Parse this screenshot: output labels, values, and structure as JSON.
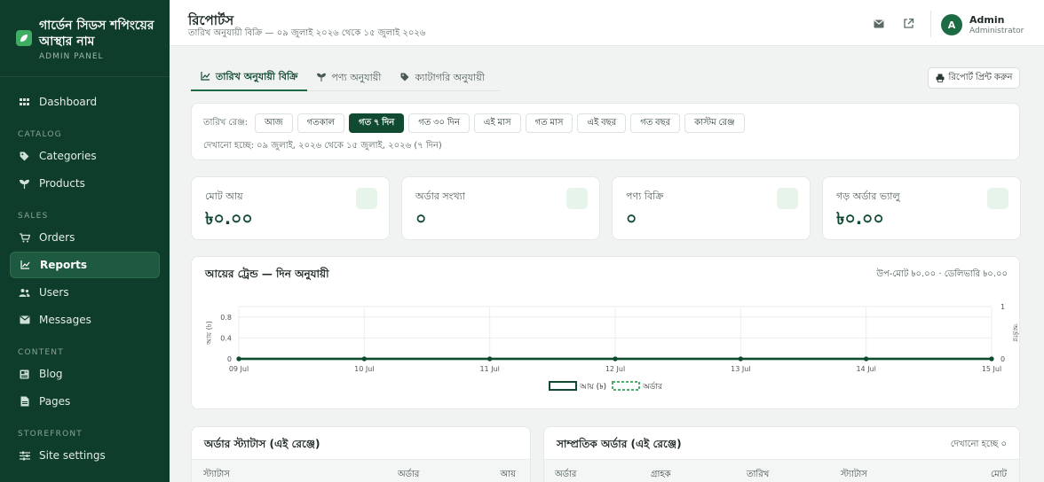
{
  "brand": {
    "title_line1": "গার্ডেন সিডস শপিংয়ের",
    "title_line2": "আস্থার নাম",
    "subtitle": "ADMIN PANEL"
  },
  "sidebar": {
    "items": [
      {
        "label": "Dashboard",
        "icon": "grid-icon"
      },
      {
        "section": "CATALOG"
      },
      {
        "label": "Categories",
        "icon": "tag-icon"
      },
      {
        "label": "Products",
        "icon": "sprout-icon"
      },
      {
        "section": "SALES"
      },
      {
        "label": "Orders",
        "icon": "cart-icon"
      },
      {
        "label": "Reports",
        "icon": "chart-line-icon",
        "active": true
      },
      {
        "label": "Users",
        "icon": "users-icon"
      },
      {
        "label": "Messages",
        "icon": "mail-icon"
      },
      {
        "section": "CONTENT"
      },
      {
        "label": "Blog",
        "icon": "newspaper-icon"
      },
      {
        "label": "Pages",
        "icon": "file-icon"
      },
      {
        "section": "STOREFRONT"
      },
      {
        "label": "Site settings",
        "icon": "sliders-icon"
      }
    ]
  },
  "header": {
    "title": "রিপোর্টস",
    "subtitle": "তারিখ অনুযায়ী বিক্রি — ০৯ জুলাই ২০২৬ থেকে ১৫ জুলাই ২০২৬",
    "user_initial": "A",
    "user_name": "Admin",
    "user_role": "Administrator"
  },
  "tabs": [
    {
      "label": "তারিখ অনুযায়ী বিক্রি",
      "icon": "chart-line-icon",
      "active": true
    },
    {
      "label": "পণ্য অনুযায়ী",
      "icon": "sprout-icon"
    },
    {
      "label": "ক্যাটাগরি অনুযায়ী",
      "icon": "tag-icon"
    }
  ],
  "print_label": "রিপোর্ট প্রিন্ট করুন",
  "range": {
    "label": "তারিখ রেঞ্জ:",
    "chips": [
      "আজ",
      "গতকাল",
      "গত ৭ দিন",
      "গত ৩০ দিন",
      "এই মাস",
      "গত মাস",
      "এই বছর",
      "গত বছর",
      "কাস্টম রেঞ্জ"
    ],
    "active_index": 2,
    "info": "দেখানো হচ্ছে: ০৯ জুলাই, ২০২৬ থেকে ১৫ জুলাই, ২০২৬ (৭ দিন)"
  },
  "stats": [
    {
      "label": "মোট আয়",
      "value": "৳০.০০"
    },
    {
      "label": "অর্ডার সংখ্যা",
      "value": "০"
    },
    {
      "label": "পণ্য বিক্রি",
      "value": "০"
    },
    {
      "label": "গড় অর্ডার ভ্যালু",
      "value": "৳০.০০"
    }
  ],
  "chart_card": {
    "title": "আয়ের ট্রেন্ড — দিন অনুযায়ী",
    "meta": "উপ-মোট ৳০.০০ · ডেলিভারি ৳০.০০"
  },
  "chart_data": {
    "type": "line",
    "categories": [
      "09 Jul",
      "10 Jul",
      "11 Jul",
      "12 Jul",
      "13 Jul",
      "14 Jul",
      "15 Jul"
    ],
    "series": [
      {
        "name": "আয় (৳)",
        "values": [
          0,
          0,
          0,
          0,
          0,
          0,
          0
        ],
        "axis": "left",
        "color": "#0f4a31"
      },
      {
        "name": "অর্ডার",
        "values": [
          0,
          0,
          0,
          0,
          0,
          0,
          0
        ],
        "axis": "right",
        "color": "#4caf6a"
      }
    ],
    "ylabel_left": "আয় (৳)",
    "ylabel_right": "অর্ডার",
    "ylim_left": [
      0,
      1
    ],
    "yticks_left": [
      "0",
      "0.4",
      "0.8"
    ],
    "yticks_left_values": [
      0,
      0.4,
      0.8
    ],
    "ylim_right": [
      0,
      1
    ],
    "yticks_right": [
      "0",
      "1"
    ],
    "yticks_right_values": [
      0,
      1
    ],
    "grid": true,
    "legend": "bottom-center"
  },
  "order_status": {
    "title": "অর্ডার স্ট্যাটাস (এই রেঞ্জে)",
    "columns": [
      "স্ট্যাটাস",
      "অর্ডার",
      "আয়"
    ]
  },
  "recent_orders": {
    "title": "সাম্প্রতিক অর্ডার (এই রেঞ্জে)",
    "right": "দেখানো হচ্ছে ০",
    "columns": [
      "অর্ডার",
      "গ্রাহক",
      "তারিখ",
      "স্ট্যাটাস",
      "মোট"
    ]
  },
  "colors": {
    "sidebar_bg": "#0f3d2b",
    "accent": "#0f4a31",
    "active_nav": "#1d5a3f"
  }
}
